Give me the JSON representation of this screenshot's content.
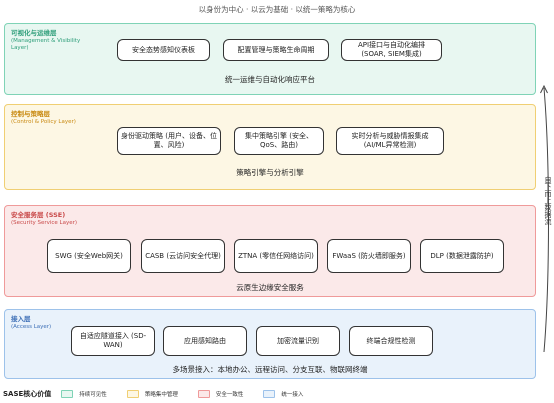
{
  "header": {
    "subtitle": "以身份为中心 · 以云为基础 · 以统一策略为核心"
  },
  "layers": [
    {
      "title": "可视化与运维层",
      "subtitle": "(Management & Visibility Layer)",
      "boxes": [
        "安全态势感知仪表板",
        "配置管理与策略生命周期",
        "API接口与自动化编排 (SOAR, SIEM集成)"
      ],
      "caption": "统一运维与自动化响应平台"
    },
    {
      "title": "控制与策略层",
      "subtitle": "(Control & Policy Layer)",
      "boxes": [
        "身份驱动策略 (用户、设备、位置、风险)",
        "集中策略引擎 (安全、QoS、路由)",
        "实时分析与威胁情报集成 (AI/ML异常检测)"
      ],
      "caption": "策略引擎与分析引擎"
    },
    {
      "title": "安全服务层 (SSE)",
      "subtitle": "(Security Service Layer)",
      "boxes": [
        "SWG (安全Web网关)",
        "CASB (云访问安全代理)",
        "ZTNA (零信任网络访问)",
        "FWaaS (防火墙即服务)",
        "DLP (数据泄露防护)"
      ],
      "caption": "云原生边缘安全服务"
    },
    {
      "title": "接入层",
      "subtitle": "(Access Layer)",
      "boxes": [
        "自适应隧道接入 (SD-WAN)",
        "应用感知路由",
        "加密流量识别",
        "终端合规性检测"
      ],
      "caption": "多场景接入：本地办公、远程访问、分支互联、物联网终端"
    }
  ],
  "side_label": "自下而上数据流",
  "legend": {
    "title": "SASE核心价值",
    "items": [
      {
        "label": "持续可见性",
        "fill": "#e8f7f1",
        "border": "#7fd3b6"
      },
      {
        "label": "策略集中管理",
        "fill": "#fdf7e4",
        "border": "#f0cf73"
      },
      {
        "label": "安全一致性",
        "fill": "#fbe9e9",
        "border": "#ef9a9a"
      },
      {
        "label": "统一接入",
        "fill": "#e9f2fb",
        "border": "#9dc2ea"
      }
    ]
  }
}
